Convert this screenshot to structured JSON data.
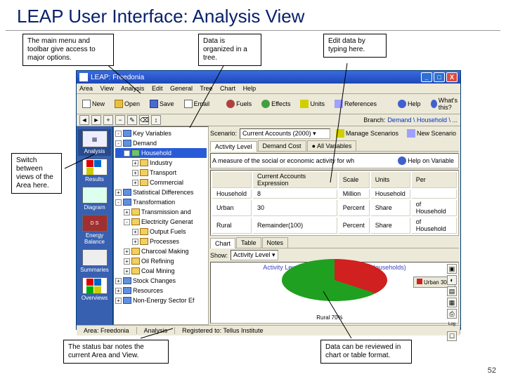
{
  "slide": {
    "title": "LEAP User Interface: Analysis View",
    "page": "52"
  },
  "callouts": {
    "c1": "The main menu and toolbar give access to major options.",
    "c2": "Data is organized in a tree.",
    "c3": "Edit data by typing here.",
    "c4": "Switch between views of the Area here.",
    "c5": "The status bar notes the current Area and View.",
    "c6": "Data can be reviewed in chart or table format."
  },
  "window": {
    "title": "LEAP: Freedonia",
    "win_min": "_",
    "win_max": "□",
    "win_close": "X"
  },
  "menu": {
    "items": [
      "Area",
      "View",
      "Analysis",
      "Edit",
      "General",
      "Tree",
      "Chart",
      "Help"
    ]
  },
  "toolbar": {
    "new": "New",
    "open": "Open",
    "save": "Save",
    "email": "Email",
    "fuels": "Fuels",
    "effects": "Effects",
    "units": "Units",
    "references": "References",
    "help": "Help",
    "whats": "What's this?"
  },
  "minitoolbar": {
    "btns": [
      "◄",
      "►",
      "+",
      "−",
      "✎",
      "⌫",
      "↕"
    ],
    "branch_lbl": "Branch:",
    "branch_val": "Demand \\ Household \\ ..."
  },
  "viewbar": {
    "items": [
      "Analysis",
      "Results",
      "Diagram",
      "Energy Balance",
      "Summaries",
      "Overviews"
    ]
  },
  "tree": {
    "nodes": [
      {
        "ind": 0,
        "exp": "-",
        "cls": "b",
        "label": "Key Variables"
      },
      {
        "ind": 0,
        "exp": "-",
        "cls": "b",
        "label": "Demand"
      },
      {
        "ind": 1,
        "exp": "-",
        "cls": "g",
        "label": "Household",
        "sel": true
      },
      {
        "ind": 2,
        "exp": "+",
        "cls": "",
        "label": "Industry"
      },
      {
        "ind": 2,
        "exp": "+",
        "cls": "",
        "label": "Transport"
      },
      {
        "ind": 2,
        "exp": "+",
        "cls": "",
        "label": "Commercial"
      },
      {
        "ind": 0,
        "exp": "+",
        "cls": "b",
        "label": "Statistical Differences"
      },
      {
        "ind": 0,
        "exp": "-",
        "cls": "b",
        "label": "Transformation"
      },
      {
        "ind": 1,
        "exp": "+",
        "cls": "",
        "label": "Transmission and"
      },
      {
        "ind": 1,
        "exp": "-",
        "cls": "",
        "label": "Electricity Generat"
      },
      {
        "ind": 2,
        "exp": "+",
        "cls": "",
        "label": "Output Fuels"
      },
      {
        "ind": 2,
        "exp": "+",
        "cls": "",
        "label": "Processes"
      },
      {
        "ind": 1,
        "exp": "+",
        "cls": "",
        "label": "Charcoal Making"
      },
      {
        "ind": 1,
        "exp": "+",
        "cls": "",
        "label": "Oil Refining"
      },
      {
        "ind": 1,
        "exp": "+",
        "cls": "",
        "label": "Coal Mining"
      },
      {
        "ind": 0,
        "exp": "+",
        "cls": "b",
        "label": "Stock Changes"
      },
      {
        "ind": 0,
        "exp": "+",
        "cls": "b",
        "label": "Resources"
      },
      {
        "ind": 0,
        "exp": "+",
        "cls": "b",
        "label": "Non-Energy Sector Ef"
      }
    ]
  },
  "scenario": {
    "label": "Scenario:",
    "value": "Current Accounts (2000)",
    "manage": "Manage Scenarios",
    "newscn": "New Scenario"
  },
  "vartabs": {
    "items": [
      "Activity Level",
      "Demand Cost",
      "All Variables"
    ],
    "sel": 0
  },
  "desc": {
    "text": "A measure of the social or economic activity for wh",
    "help": "Help on Variable"
  },
  "table": {
    "headers": [
      "",
      "Current Accounts Expression",
      "Scale",
      "Units",
      "Per"
    ],
    "rows": [
      [
        "Household",
        "8",
        "Million",
        "Household",
        ""
      ],
      [
        "Urban",
        "30",
        "Percent",
        "Share",
        "of Household"
      ],
      [
        "Rural",
        "Remainder(100)",
        "Percent",
        "Share",
        "of Household"
      ]
    ]
  },
  "charttabs": {
    "items": [
      "Chart",
      "Table",
      "Notes"
    ],
    "sel": 0
  },
  "chartshow": {
    "label": "Show:",
    "value": "Activity Level"
  },
  "chart_data": {
    "type": "pie",
    "title": "Activity Level: Household (% Share of Households)",
    "categories": [
      "Urban",
      "Rural"
    ],
    "values": [
      30,
      70
    ],
    "labels": [
      "Urban 30%",
      "Rural 70%"
    ],
    "colors": [
      "#d02020",
      "#20a020"
    ],
    "legend_position": "right"
  },
  "statusbar": {
    "area_lbl": "Area:",
    "area_val": "Freedonia",
    "view_val": "Analysis",
    "reg_lbl": "Registered to:",
    "reg_val": "Tellus Institute"
  }
}
